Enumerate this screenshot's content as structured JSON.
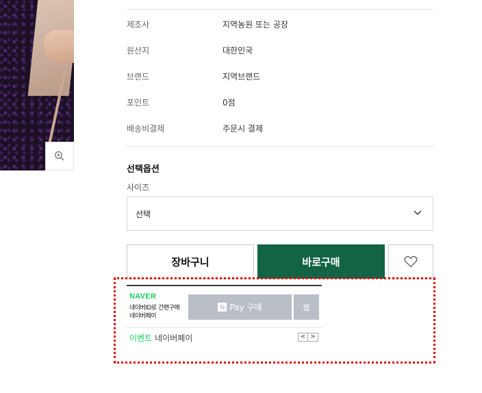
{
  "product_info": [
    {
      "label": "제조사",
      "value": "지역농원 또는 공장"
    },
    {
      "label": "원산지",
      "value": "대한민국"
    },
    {
      "label": "브랜드",
      "value": "지역브랜드"
    },
    {
      "label": "포인트",
      "value": "0점"
    },
    {
      "label": "배송비결제",
      "value": "주문시 결제"
    }
  ],
  "options": {
    "title": "선택옵션",
    "size_label": "사이즈",
    "size_selected": "선택"
  },
  "actions": {
    "cart": "장바구니",
    "buy": "바로구매"
  },
  "naver_pay": {
    "logo": "NAVER",
    "desc_line1": "네이버ID로 간편구매",
    "desc_line2": "네이버페이",
    "pay_button": "Pay 구매",
    "pay_badge": "N",
    "zzim_button": "찜",
    "event_label": "이벤트",
    "event_name": "네이버페이",
    "prev": "<",
    "next": ">"
  },
  "colors": {
    "buy_button": "#126444",
    "naver_green": "#19ce60",
    "highlight_border": "#e00000"
  }
}
